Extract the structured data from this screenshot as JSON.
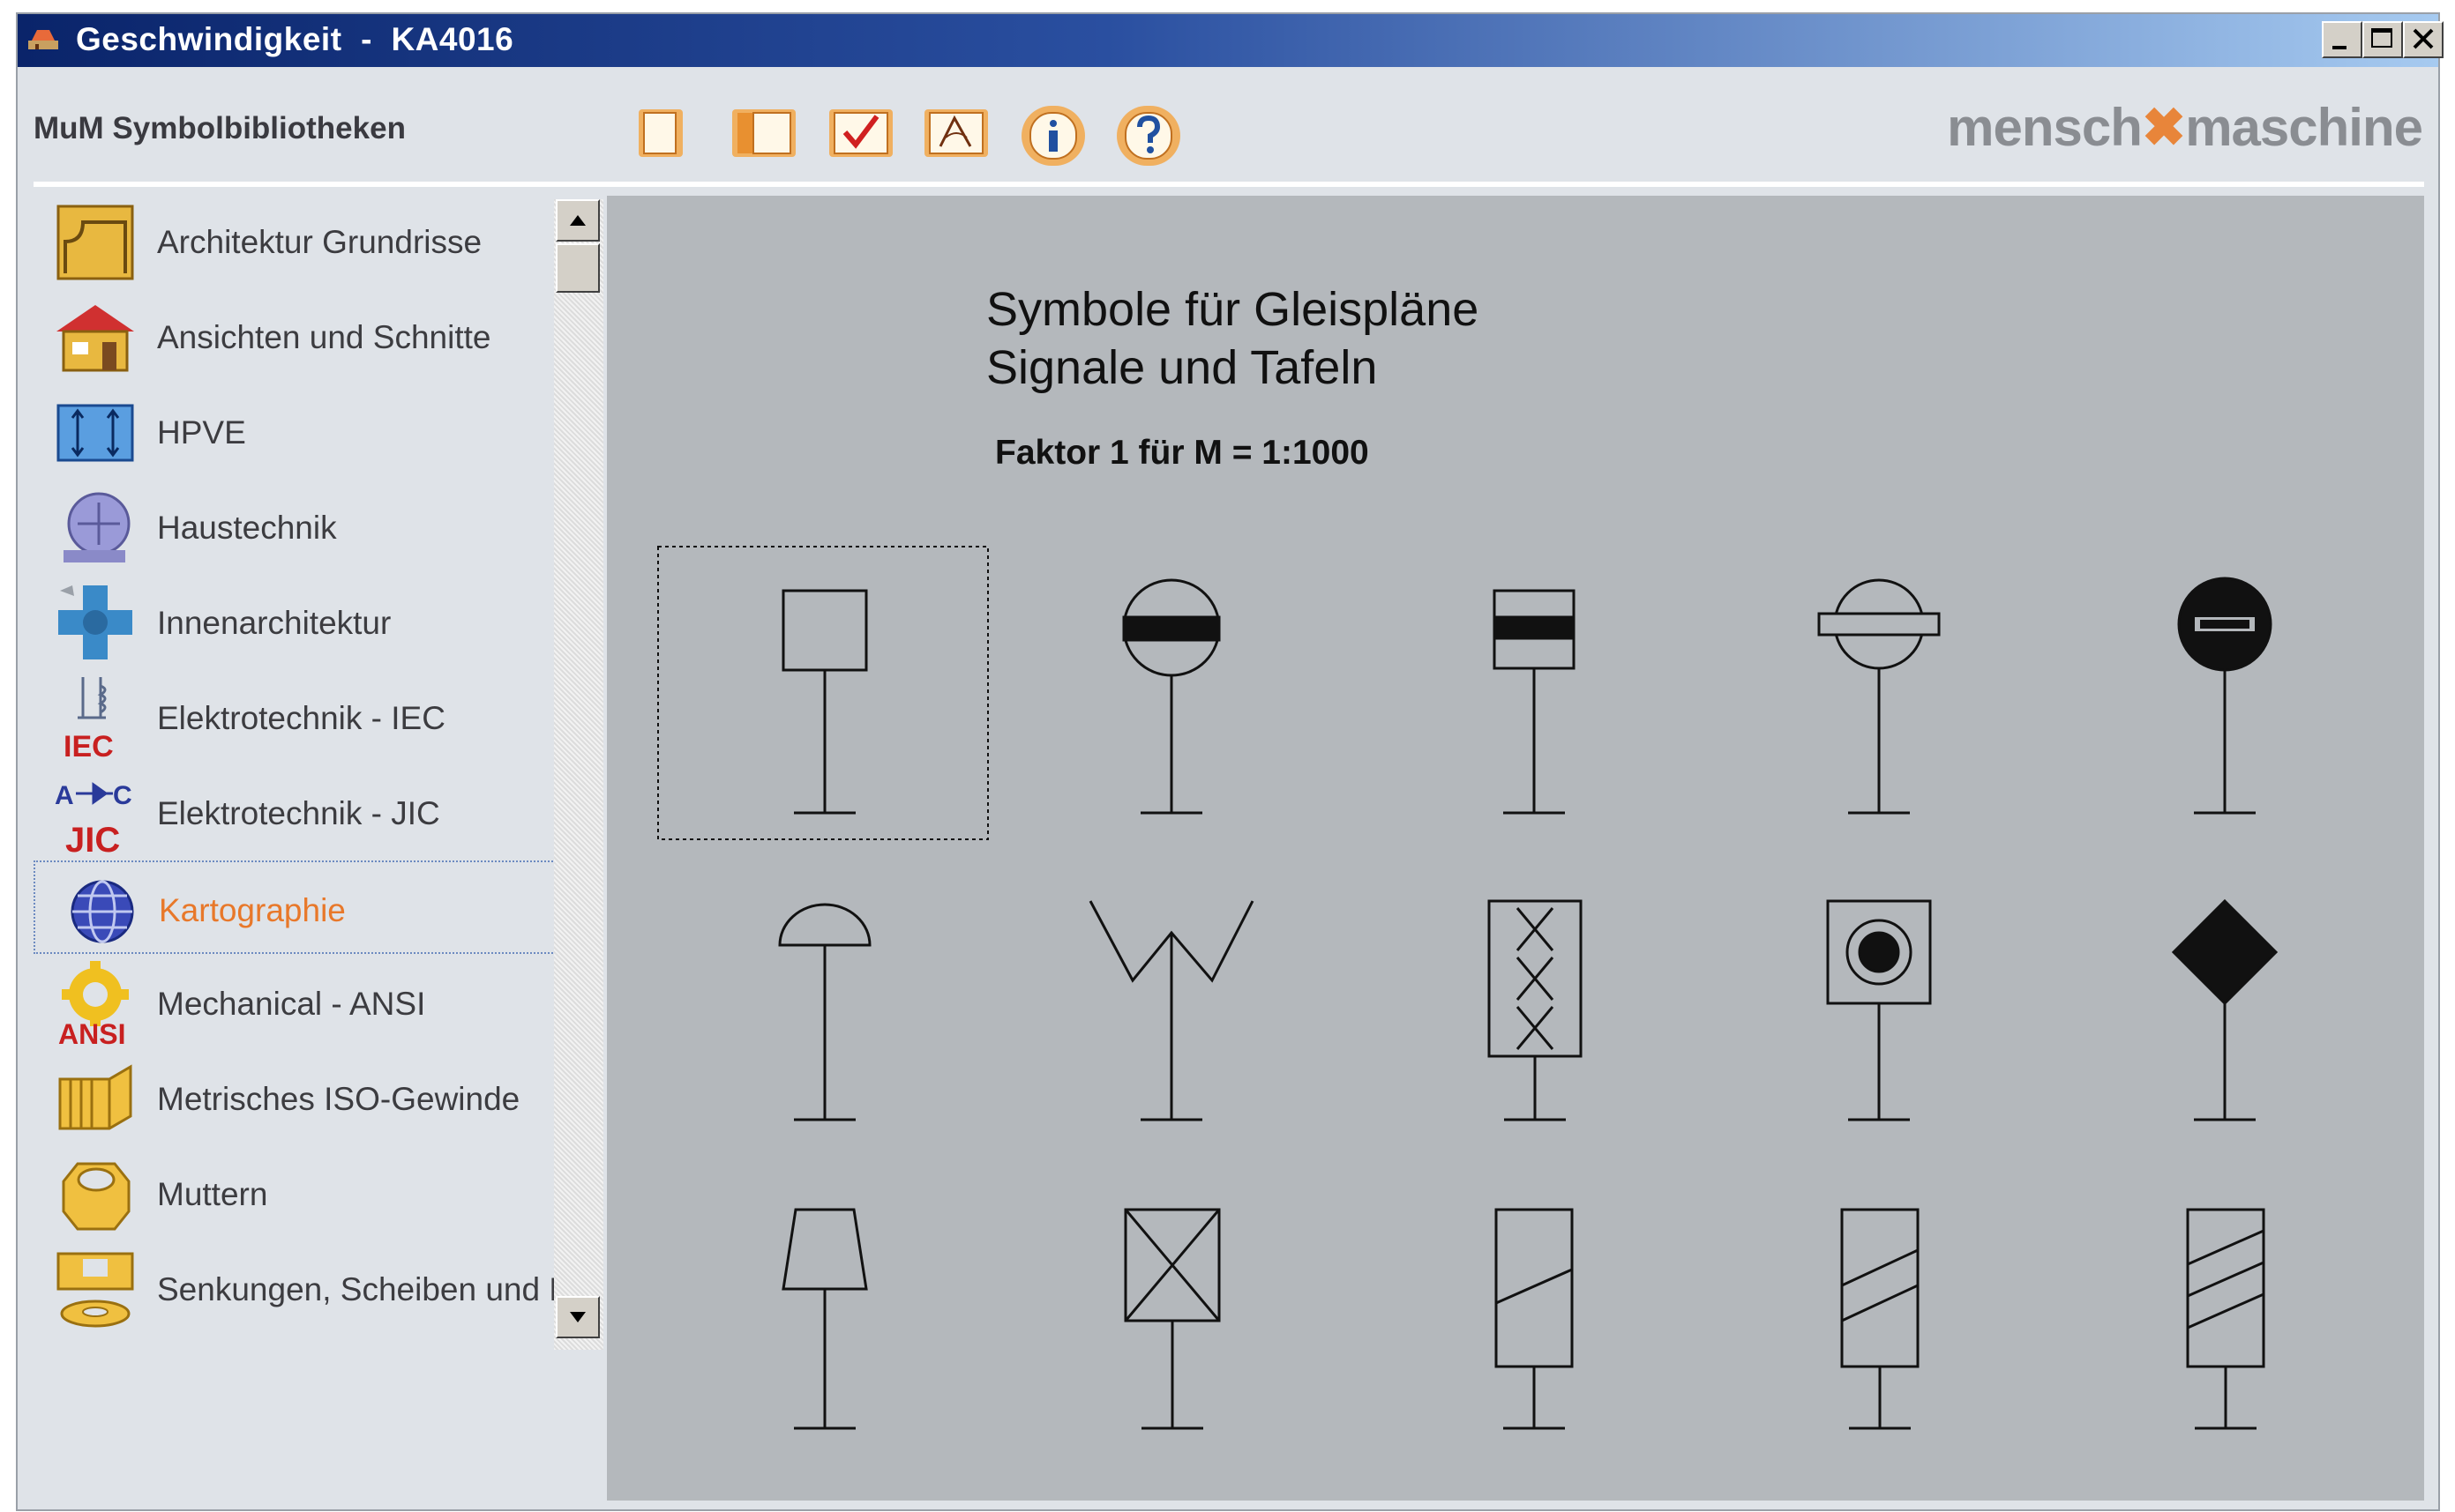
{
  "window": {
    "title": "Geschwindigkeit  -  KA4016",
    "controls": [
      "minimize",
      "maximize",
      "close"
    ]
  },
  "header": {
    "label": "MuM Symbolbibliotheken",
    "toolbar": [
      {
        "name": "new-page-button",
        "icon": "blank-page-icon"
      },
      {
        "name": "book-button",
        "icon": "book-icon"
      },
      {
        "name": "check-button",
        "icon": "checkmark-icon"
      },
      {
        "name": "edit-button",
        "icon": "compass-icon"
      },
      {
        "name": "info-button",
        "icon": "info-icon"
      },
      {
        "name": "help-button",
        "icon": "question-icon"
      }
    ],
    "logo": {
      "left": "mensch",
      "mid": "✖",
      "right": "maschine"
    }
  },
  "sidebar": {
    "items": [
      {
        "label": "Architektur Grundrisse",
        "icon": "floorplan-icon"
      },
      {
        "label": "Ansichten und Schnitte",
        "icon": "house-icon"
      },
      {
        "label": "HPVE",
        "icon": "dimension-icon"
      },
      {
        "label": "Haustechnik",
        "icon": "hvac-icon"
      },
      {
        "label": "Innenarchitektur",
        "icon": "interior-icon"
      },
      {
        "label": "Elektrotechnik - IEC",
        "icon": "iec-icon",
        "badge": "IEC"
      },
      {
        "label": "Elektrotechnik - JIC",
        "icon": "jic-icon",
        "badge": "JIC"
      },
      {
        "label": "Kartographie",
        "icon": "globe-icon",
        "selected": true
      },
      {
        "label": "Mechanical - ANSI",
        "icon": "gear-icon",
        "badge": "ANSI"
      },
      {
        "label": "Metrisches ISO-Gewinde",
        "icon": "thread-icon"
      },
      {
        "label": "Muttern",
        "icon": "nut-icon"
      },
      {
        "label": "Senkungen, Scheiben und Du",
        "icon": "washer-icon"
      }
    ]
  },
  "main": {
    "title_line1": "Symbole  für  Gleispläne",
    "title_line2": "Signale und Tafeln",
    "factor": "Faktor 1 für M = 1:1000",
    "symbols": [
      "signal-square-symbol",
      "signal-circle-bar-symbol",
      "signal-rect-bar-symbol",
      "signal-circle-hbar-symbol",
      "signal-black-circle-symbol",
      "signal-half-circle-symbol",
      "signal-v-arms-symbol",
      "signal-triple-x-symbol",
      "signal-target-symbol",
      "signal-diamond-symbol",
      "signal-trapezoid-symbol",
      "signal-crossed-box-symbol",
      "signal-one-stripe-symbol",
      "signal-two-stripes-symbol",
      "signal-three-stripes-symbol"
    ],
    "selected_symbol": 0
  },
  "colors": {
    "title_bar": "#0a246a",
    "accent": "#e8782a",
    "canvas": "#b4b8bc",
    "panel": "#dfe3e8"
  }
}
